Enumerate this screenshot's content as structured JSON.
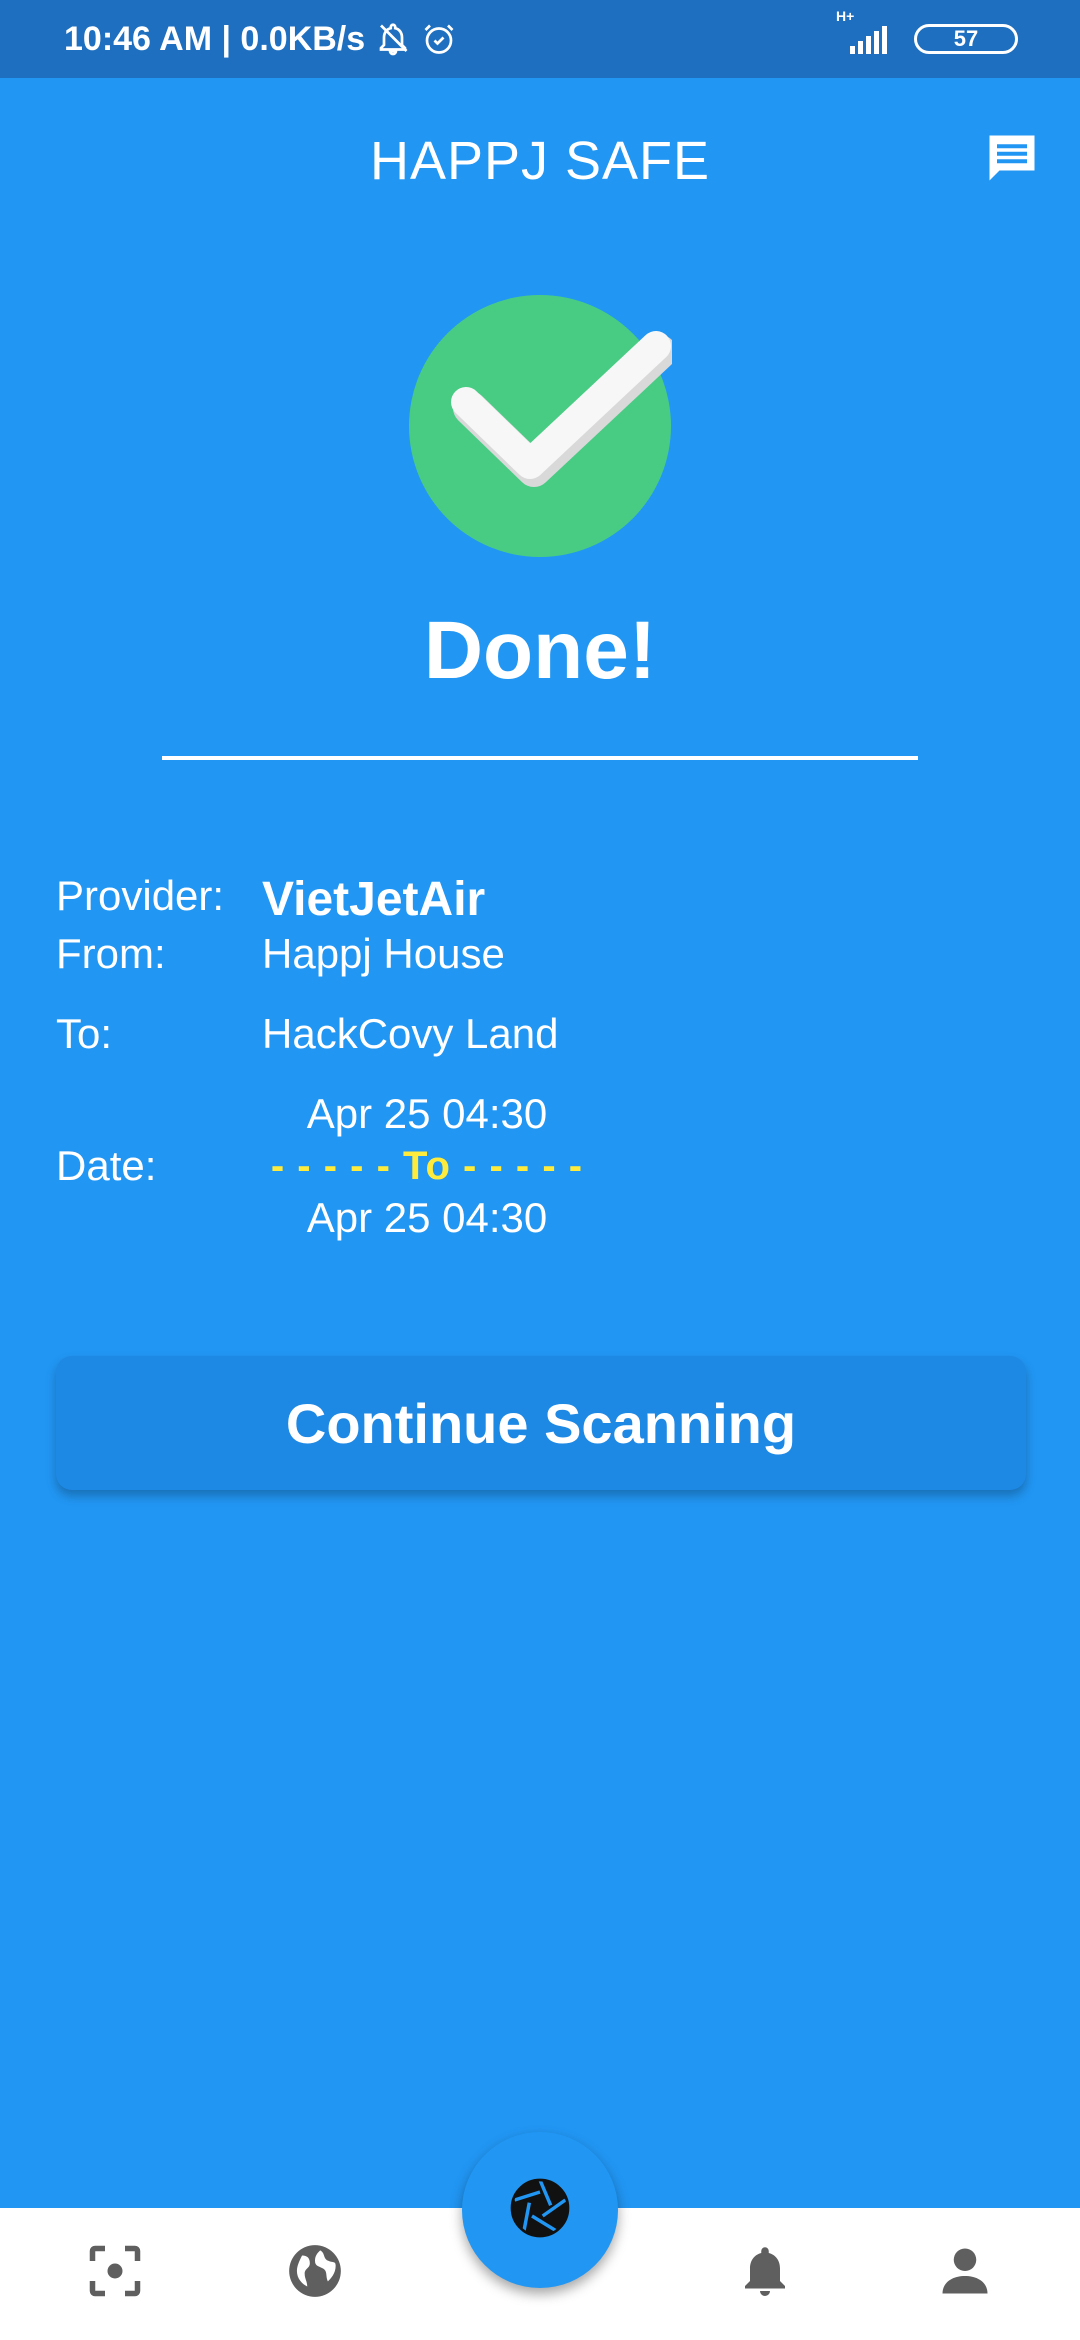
{
  "status_bar": {
    "time_speed": "10:46 AM | 0.0KB/s",
    "network": "H+",
    "battery": "57"
  },
  "header": {
    "title": "HAPPJ SAFE"
  },
  "result": {
    "title": "Done!"
  },
  "details": {
    "provider_label": "Provider:",
    "provider_value": "VietJetAir",
    "from_label": "From:",
    "from_value": "Happj House",
    "to_label": "To:",
    "to_value": "HackCovy Land",
    "date_label": "Date:",
    "date_start": "Apr 25 04:30",
    "date_separator": "- - - - - To - - - - -",
    "date_end": "Apr 25 04:30"
  },
  "actions": {
    "continue_label": "Continue Scanning"
  },
  "colors": {
    "background": "#2196F3",
    "status_bar": "#1E6FBF",
    "button": "#1E88E5",
    "check_green": "#48CC84",
    "date_separator": "#FFEB3B",
    "nav_icon": "#5F5F5F"
  },
  "icons": [
    "bell-off-icon",
    "alarm-icon",
    "signal-icon",
    "chat-icon",
    "check-circle-icon",
    "scan-icon",
    "globe-icon",
    "camera-shutter-icon",
    "notification-bell-icon",
    "profile-icon"
  ]
}
